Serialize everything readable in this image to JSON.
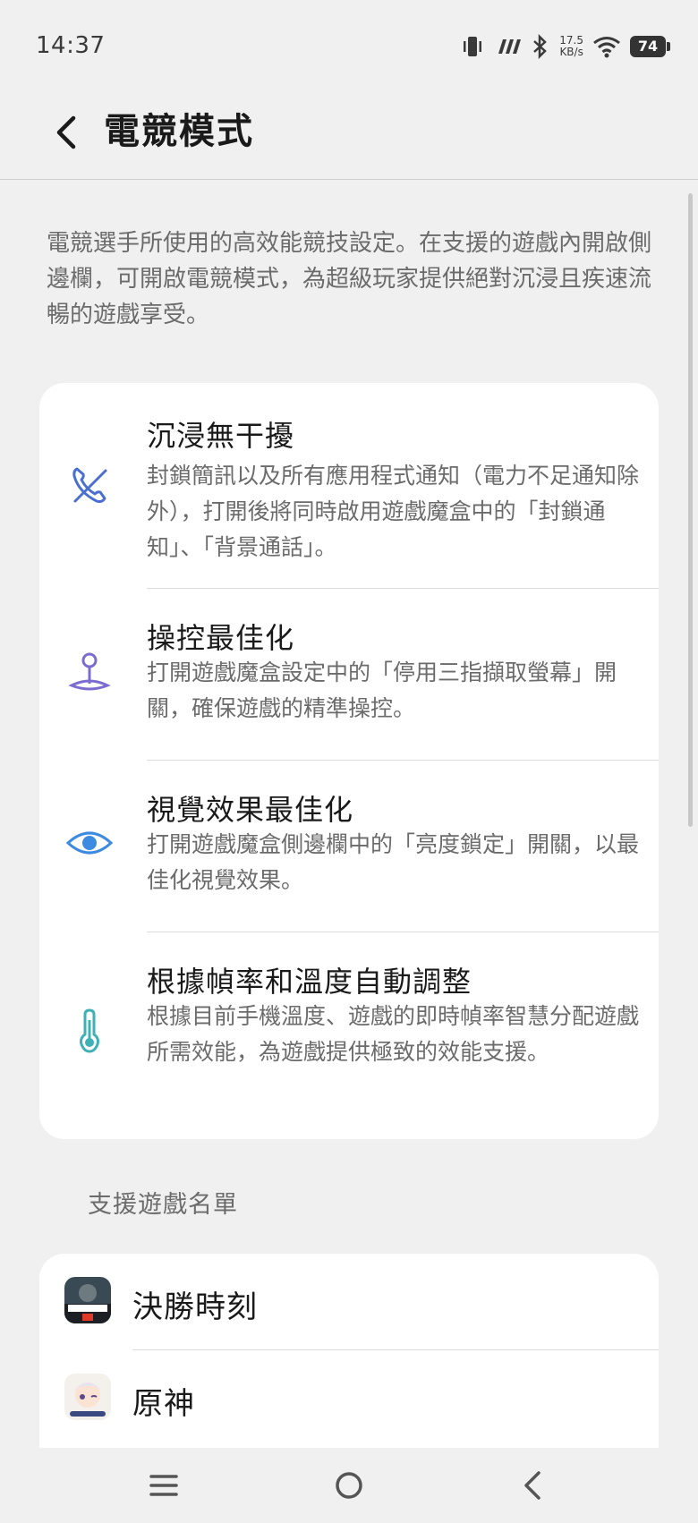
{
  "status_bar": {
    "time": "14:37",
    "net_speed_value": "17.5",
    "net_speed_unit": "KB/s",
    "battery": "74",
    "icons": [
      "vibrate-icon",
      "signal-icon",
      "bluetooth-icon",
      "wifi-icon",
      "battery-icon"
    ]
  },
  "header": {
    "title": "電競模式"
  },
  "description": "電競選手所使用的高效能競技設定。在支援的遊戲內開啟側邊欄，可開啟電競模式，為超級玩家提供絕對沉浸且疾速流暢的遊戲享受。",
  "features": [
    {
      "title": "沉浸無干擾",
      "desc": "封鎖簡訊以及所有應用程式通知（電力不足通知除外），打開後將同時啟用遊戲魔盒中的「封鎖通知」、「背景通話」。",
      "icon": "call-block-icon",
      "color": "#4a6fd0"
    },
    {
      "title": "操控最佳化",
      "desc": "打開遊戲魔盒設定中的「停用三指擷取螢幕」開關，確保遊戲的精準操控。",
      "icon": "joystick-icon",
      "color": "#7c6ccf"
    },
    {
      "title": "視覺效果最佳化",
      "desc": "打開遊戲魔盒側邊欄中的「亮度鎖定」開關，以最佳化視覺效果。",
      "icon": "eye-icon",
      "color": "#3d8be0"
    },
    {
      "title": "根據幀率和溫度自動調整",
      "desc": "根據目前手機溫度、遊戲的即時幀率智慧分配遊戲所需效能，為遊戲提供極致的效能支援。",
      "icon": "thermometer-icon",
      "color": "#3fb1b6"
    }
  ],
  "games_section": {
    "label": "支援遊戲名單",
    "games": [
      {
        "name": "決勝時刻",
        "icon": "call-of-duty-app-icon"
      },
      {
        "name": "原神",
        "icon": "genshin-app-icon"
      }
    ]
  },
  "nav_bar": {
    "icons": [
      "menu-icon",
      "home-icon",
      "back-icon"
    ]
  }
}
